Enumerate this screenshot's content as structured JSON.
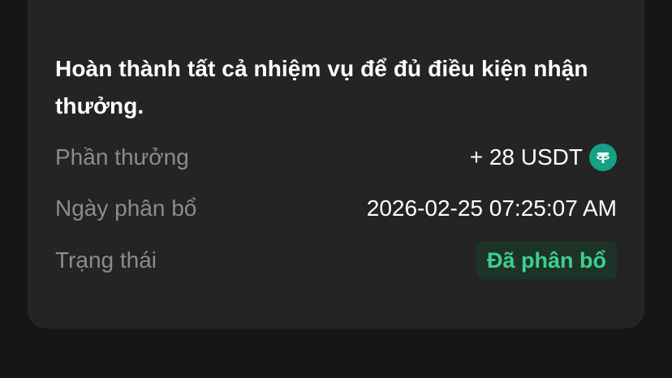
{
  "description": "Hoàn thành tất cả nhiệm vụ để đủ điều kiện nhận thưởng.",
  "rows": {
    "reward": {
      "label": "Phần thưởng",
      "value": "+ 28 USDT",
      "icon": "usdt-icon"
    },
    "date": {
      "label": "Ngày phân bổ",
      "value": "2026-02-25 07:25:07 AM"
    },
    "status": {
      "label": "Trạng thái",
      "value": "Đã phân bổ",
      "color": "#3ecf8e"
    }
  },
  "colors": {
    "background": "#161616",
    "card": "#242424",
    "usdt": "#16a085",
    "status_bg": "#1d3328"
  }
}
